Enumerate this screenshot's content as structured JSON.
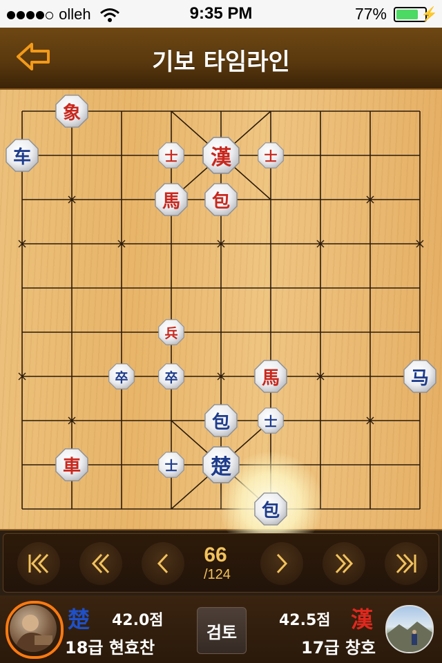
{
  "status_bar": {
    "carrier": "olleh",
    "time": "9:35 PM",
    "battery_pct": "77%",
    "battery_level": 0.77,
    "icons": [
      "signal-dots-icon",
      "wifi-icon",
      "battery-icon",
      "charging-bolt-icon"
    ]
  },
  "header": {
    "title": "기보 타임라인",
    "back_icon": "back-arrow-icon"
  },
  "board": {
    "files": 9,
    "ranks": 10,
    "highlight_piece_index": 16,
    "pieces": [
      {
        "char": "象",
        "side": "red",
        "col": 1,
        "row": 0,
        "size": "large"
      },
      {
        "char": "车",
        "side": "blue",
        "col": 0,
        "row": 1,
        "size": "large"
      },
      {
        "char": "士",
        "side": "red",
        "col": 3,
        "row": 1,
        "size": "small"
      },
      {
        "char": "漢",
        "side": "red",
        "col": 4,
        "row": 1,
        "size": "king"
      },
      {
        "char": "士",
        "side": "red",
        "col": 5,
        "row": 1,
        "size": "small"
      },
      {
        "char": "馬",
        "side": "red",
        "col": 3,
        "row": 2,
        "size": "large"
      },
      {
        "char": "包",
        "side": "red",
        "col": 4,
        "row": 2,
        "size": "large"
      },
      {
        "char": "兵",
        "side": "red",
        "col": 3,
        "row": 5,
        "size": "small"
      },
      {
        "char": "卒",
        "side": "blue",
        "col": 2,
        "row": 6,
        "size": "small"
      },
      {
        "char": "卒",
        "side": "blue",
        "col": 3,
        "row": 6,
        "size": "small"
      },
      {
        "char": "馬",
        "side": "red",
        "col": 5,
        "row": 6,
        "size": "large"
      },
      {
        "char": "马",
        "side": "blue",
        "col": 8,
        "row": 6,
        "size": "large"
      },
      {
        "char": "包",
        "side": "blue",
        "col": 4,
        "row": 7,
        "size": "large"
      },
      {
        "char": "士",
        "side": "blue",
        "col": 5,
        "row": 7,
        "size": "small"
      },
      {
        "char": "車",
        "side": "red",
        "col": 1,
        "row": 8,
        "size": "large"
      },
      {
        "char": "士",
        "side": "blue",
        "col": 3,
        "row": 8,
        "size": "small"
      },
      {
        "char": "包",
        "side": "blue",
        "col": 5,
        "row": 9,
        "size": "large"
      },
      {
        "char": "楚",
        "side": "blue",
        "col": 4,
        "row": 8,
        "size": "king"
      }
    ],
    "colors": {
      "red": "#c8281e",
      "blue": "#1e3c8c",
      "line": "#2a1a0a"
    }
  },
  "controls": {
    "move_number": "66",
    "move_total": "/124",
    "buttons": [
      "first-move-icon",
      "prev-fast-icon",
      "prev-icon",
      "next-icon",
      "next-fast-icon",
      "last-move-icon"
    ]
  },
  "players": {
    "left": {
      "tag": "楚",
      "tag_color": "#1e50c8",
      "score": "42.0점",
      "name": "18급 현효찬"
    },
    "right": {
      "tag": "漢",
      "tag_color": "#e0281e",
      "score": "42.5점",
      "name": "17급 창호"
    },
    "review_label": "검토"
  }
}
